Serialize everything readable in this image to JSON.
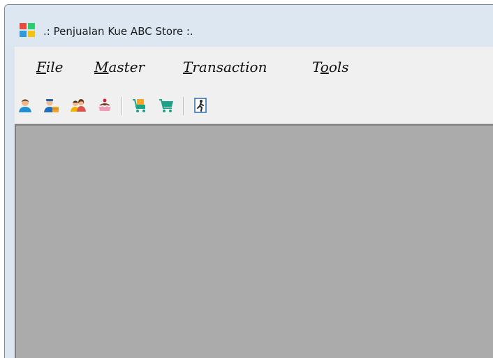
{
  "window": {
    "title": ".: Penjualan Kue ABC Store :.",
    "app_icon": "windows-tiles-icon",
    "app_icon_colors": [
      "#e74c3c",
      "#2ecc71",
      "#3498db",
      "#f1c40f"
    ]
  },
  "menubar": {
    "items": [
      {
        "mnemonic": "F",
        "rest": "ile"
      },
      {
        "mnemonic": "M",
        "rest": "aster"
      },
      {
        "mnemonic": "T",
        "rest": "ransaction"
      },
      {
        "pre": "T",
        "mnemonic": "o",
        "rest": "ols"
      }
    ]
  },
  "toolbar": {
    "buttons": [
      {
        "icon": "user-icon"
      },
      {
        "icon": "supplier-icon"
      },
      {
        "icon": "customers-icon"
      },
      {
        "icon": "cake-icon"
      },
      {
        "icon": "purchase-cart-icon"
      },
      {
        "icon": "sales-cart-icon"
      },
      {
        "icon": "exit-icon"
      }
    ]
  },
  "colors": {
    "mdi_background": "#ababab",
    "titlebar": "#dde7f2",
    "menubar": "#f0f0f0"
  }
}
